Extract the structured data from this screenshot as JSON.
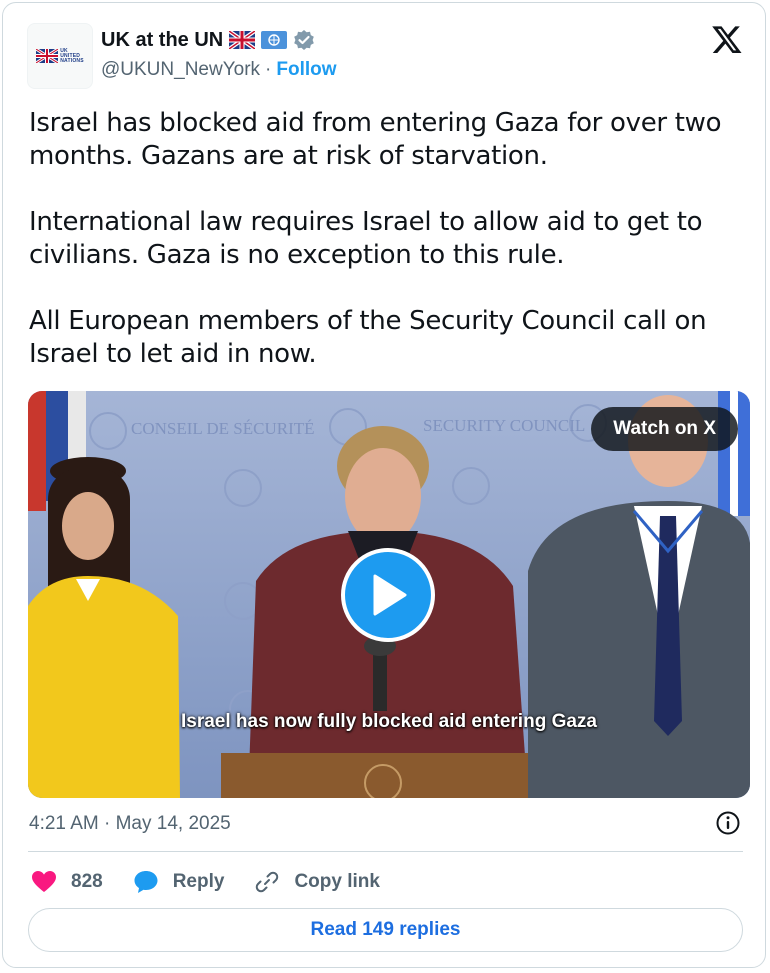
{
  "account": {
    "display_name": "UK at the UN",
    "handle": "@UKUN_NewYork",
    "separator": "·",
    "follow_label": "Follow",
    "avatar_text": [
      "UK",
      "UNITED",
      "NATIONS"
    ]
  },
  "tweet": {
    "paragraphs": [
      "Israel has blocked aid from entering Gaza for over two months. Gazans are at risk of starvation.",
      "International law requires Israel to allow aid to get to civilians. Gaza is no exception to this rule.",
      "All European members of the Security Council call on Israel to let aid in now."
    ]
  },
  "media": {
    "watch_label": "Watch on X",
    "caption": "Israel has now fully blocked aid entering Gaza",
    "backdrop_texts": [
      "CONSEIL DE SÉCURITÉ",
      "SECURITY COUNCIL"
    ]
  },
  "meta": {
    "timestamp": "4:21 AM · May 14, 2025"
  },
  "actions": {
    "like_count": "828",
    "reply_label": "Reply",
    "copy_link_label": "Copy link"
  },
  "read_replies_label": "Read 149 replies",
  "colors": {
    "accent": "#1d9bf0",
    "like": "#f91880",
    "muted": "#536471"
  }
}
